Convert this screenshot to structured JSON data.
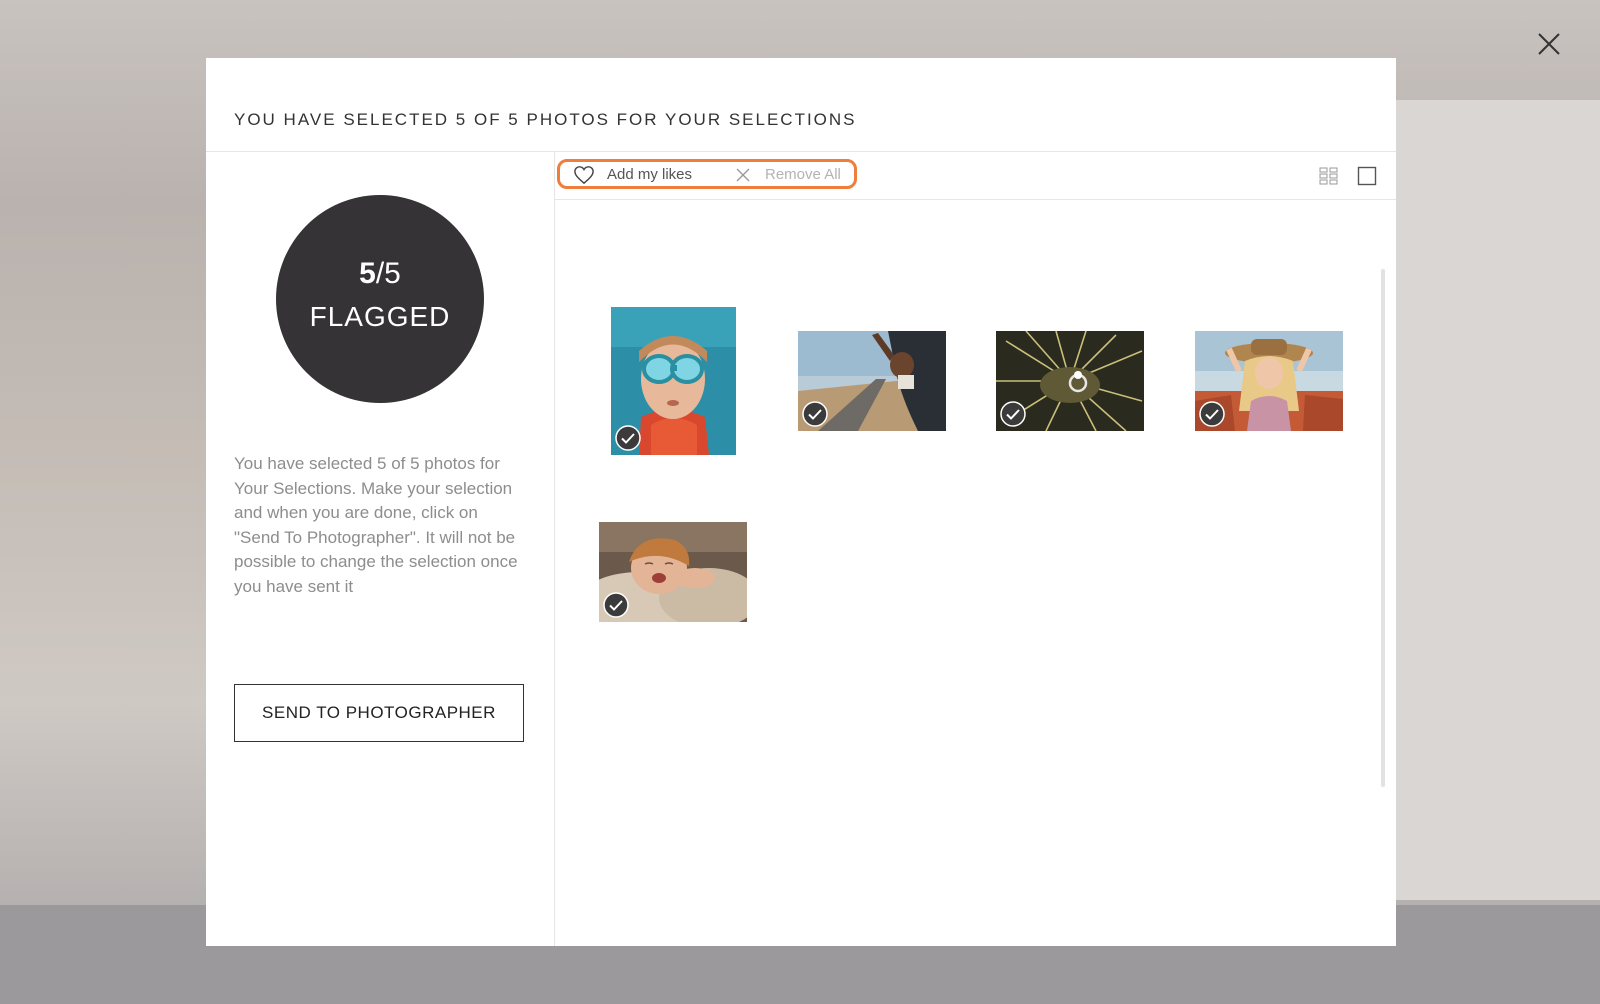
{
  "modal": {
    "title": "YOU HAVE SELECTED 5 OF 5 PHOTOS FOR YOUR SELECTIONS",
    "close_icon": "close-icon"
  },
  "summary": {
    "selected": "5",
    "separator": "/",
    "total": "5",
    "status_label": "FLAGGED",
    "description": "You have selected 5 of 5 photos for Your Selections. Make your selection and when you are done, click on \"Send To Photographer\". It will not be possible to change the selection once you have sent it",
    "send_button_label": "SEND TO PHOTOGRAPHER"
  },
  "toolbar": {
    "add_likes_icon": "heart-icon",
    "add_likes_label": "Add my likes",
    "remove_all_icon": "close-icon",
    "remove_all_label": "Remove All",
    "grid_view_icon": "grid-view-icon",
    "single_view_icon": "single-view-icon",
    "highlight_color": "#ef7d3c"
  },
  "photos": [
    {
      "subject": "girl-with-swim-goggles",
      "selected": true,
      "check_icon": "check-circle-icon"
    },
    {
      "subject": "child-out-of-train-window",
      "selected": true,
      "check_icon": "check-circle-icon"
    },
    {
      "subject": "ring-on-cactus",
      "selected": true,
      "check_icon": "check-circle-icon"
    },
    {
      "subject": "woman-in-hat-in-car",
      "selected": true,
      "check_icon": "check-circle-icon"
    },
    {
      "subject": "newborn-baby-yawning",
      "selected": true,
      "check_icon": "check-circle-icon"
    }
  ],
  "colors": {
    "circle_bg": "#353335",
    "modal_bg": "#ffffff",
    "description_text": "#8d8d8d"
  }
}
